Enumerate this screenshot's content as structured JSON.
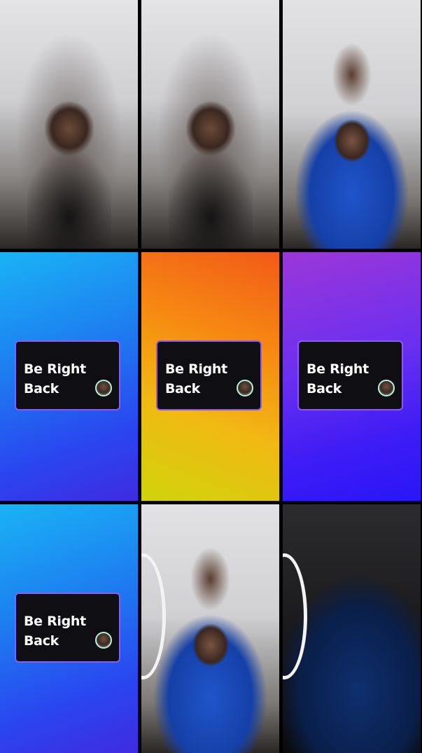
{
  "grid": {
    "tiles": [
      {
        "kind": "camera",
        "label": ""
      },
      {
        "kind": "camera",
        "label": ""
      },
      {
        "kind": "camera",
        "label": ""
      },
      {
        "kind": "brb",
        "text": "Be Right\nBack"
      },
      {
        "kind": "brb",
        "text": "Be Right\nBack"
      },
      {
        "kind": "brb",
        "text": "Be Right\nBack"
      },
      {
        "kind": "brb",
        "text": "Be Right\nBack"
      },
      {
        "kind": "camera",
        "label": ""
      },
      {
        "kind": "camera",
        "label": ""
      }
    ]
  },
  "colors": {
    "card_border": "#8c5cf0",
    "card_background": "#0f0e13",
    "avatar_ring": "#b9f1d8"
  }
}
